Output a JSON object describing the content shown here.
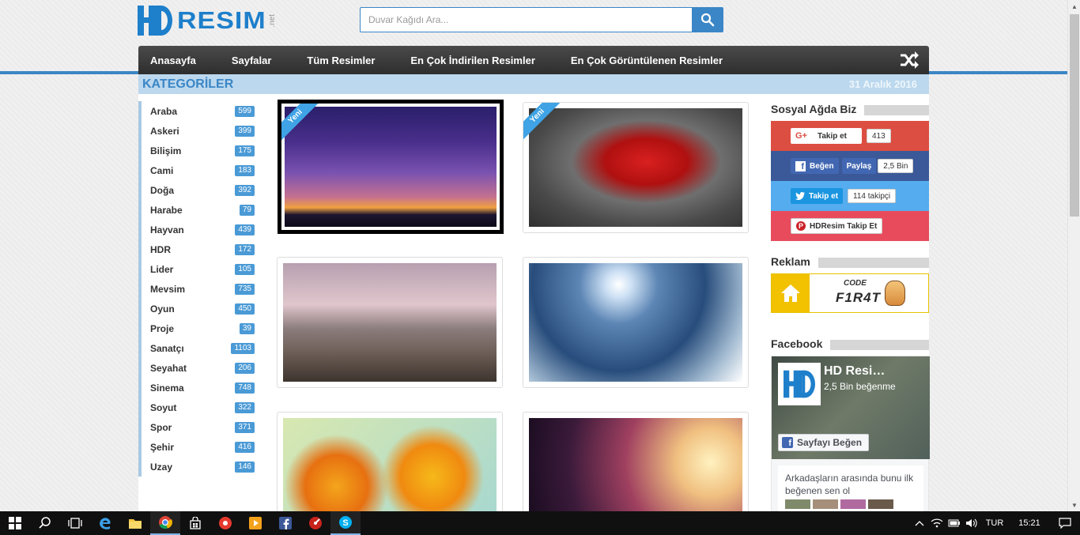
{
  "header": {
    "logo_word": "RESIM",
    "logo_net": ".net",
    "search_placeholder": "Duvar Kağıdı Ara..."
  },
  "nav": {
    "items": [
      "Anasayfa",
      "Sayfalar",
      "Tüm Resimler",
      "En Çok İndirilen Resimler",
      "En Çok Görüntülenen Resimler"
    ]
  },
  "category_header": {
    "title": "KATEGORİLER",
    "date": "31 Aralık 2016"
  },
  "categories": [
    {
      "name": "Araba",
      "count": "599"
    },
    {
      "name": "Askeri",
      "count": "399"
    },
    {
      "name": "Bilişim",
      "count": "175"
    },
    {
      "name": "Cami",
      "count": "183"
    },
    {
      "name": "Doğa",
      "count": "392"
    },
    {
      "name": "Harabe",
      "count": "79"
    },
    {
      "name": "Hayvan",
      "count": "439"
    },
    {
      "name": "HDR",
      "count": "172"
    },
    {
      "name": "Lider",
      "count": "105"
    },
    {
      "name": "Mevsim",
      "count": "735"
    },
    {
      "name": "Oyun",
      "count": "450"
    },
    {
      "name": "Proje",
      "count": "39"
    },
    {
      "name": "Sanatçı",
      "count": "1103"
    },
    {
      "name": "Seyahat",
      "count": "206"
    },
    {
      "name": "Sinema",
      "count": "748"
    },
    {
      "name": "Soyut",
      "count": "322"
    },
    {
      "name": "Spor",
      "count": "371"
    },
    {
      "name": "Şehir",
      "count": "416"
    },
    {
      "name": "Uzay",
      "count": "146"
    }
  ],
  "gallery": {
    "ribbon_label": "Yeni"
  },
  "sidebar": {
    "social_title": "Sosyal Ağda Biz",
    "gplus_button": "Takip et",
    "gplus_count": "413",
    "fb_like": "Beğen",
    "fb_share": "Paylaş",
    "fb_count": "2,5 Bin",
    "tw_button": "Takip et",
    "tw_count": "114 takipçi",
    "pin_button": "HDResim Takip Et",
    "ad_title": "Reklam",
    "ad_text": "F1R4T",
    "ad_text_small": "CODE",
    "fb_title": "Facebook",
    "fb_page_name": "HD Resi…",
    "fb_page_likes": "2,5 Bin beğenme",
    "fb_like_page": "Sayfayı Beğen",
    "fb_friends_text": "Arkadaşların arasında bunu ilk beğenen sen ol"
  },
  "taskbar": {
    "language": "TUR",
    "time": "15:21"
  },
  "colors": {
    "brand_blue": "#3b86c6",
    "gplus": "#dc4e41",
    "facebook": "#3b5998",
    "twitter": "#55acee",
    "pinterest": "#e84b5c",
    "ad_yellow": "#f2c100"
  }
}
